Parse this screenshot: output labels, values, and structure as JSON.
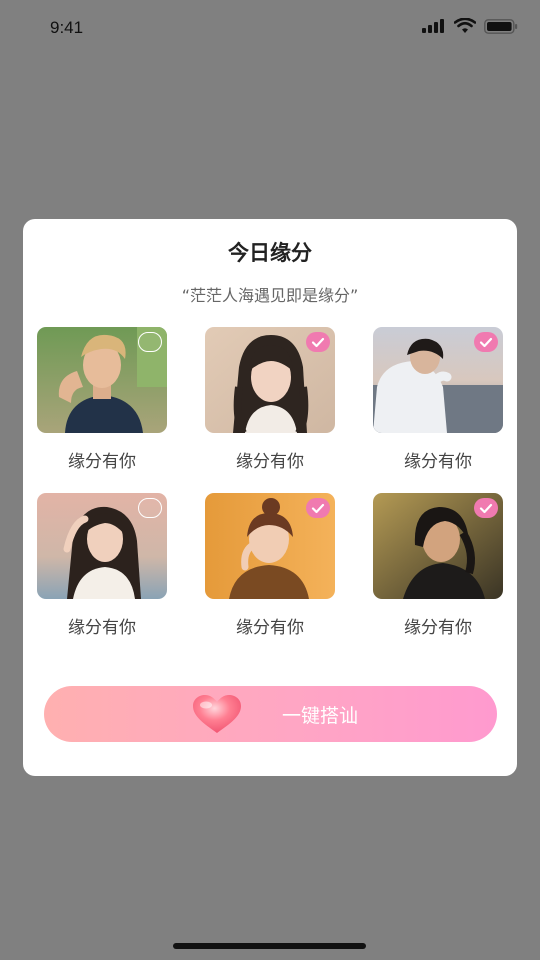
{
  "status_bar": {
    "time": "9:41"
  },
  "modal": {
    "title": "今日缘分",
    "subtitle": "“茫茫人海遇见即是缘分”",
    "cards": [
      {
        "label": "缘分有你",
        "selected": false
      },
      {
        "label": "缘分有你",
        "selected": true
      },
      {
        "label": "缘分有你",
        "selected": true
      },
      {
        "label": "缘分有你",
        "selected": false
      },
      {
        "label": "缘分有你",
        "selected": true
      },
      {
        "label": "缘分有你",
        "selected": true
      }
    ],
    "cta": {
      "label": "一键搭讪"
    }
  },
  "colors": {
    "backdrop": "#808080",
    "accent_check": "#f07ab0",
    "cta_gradient_start": "#ffb0b0",
    "cta_gradient_end": "#ff9acf"
  }
}
